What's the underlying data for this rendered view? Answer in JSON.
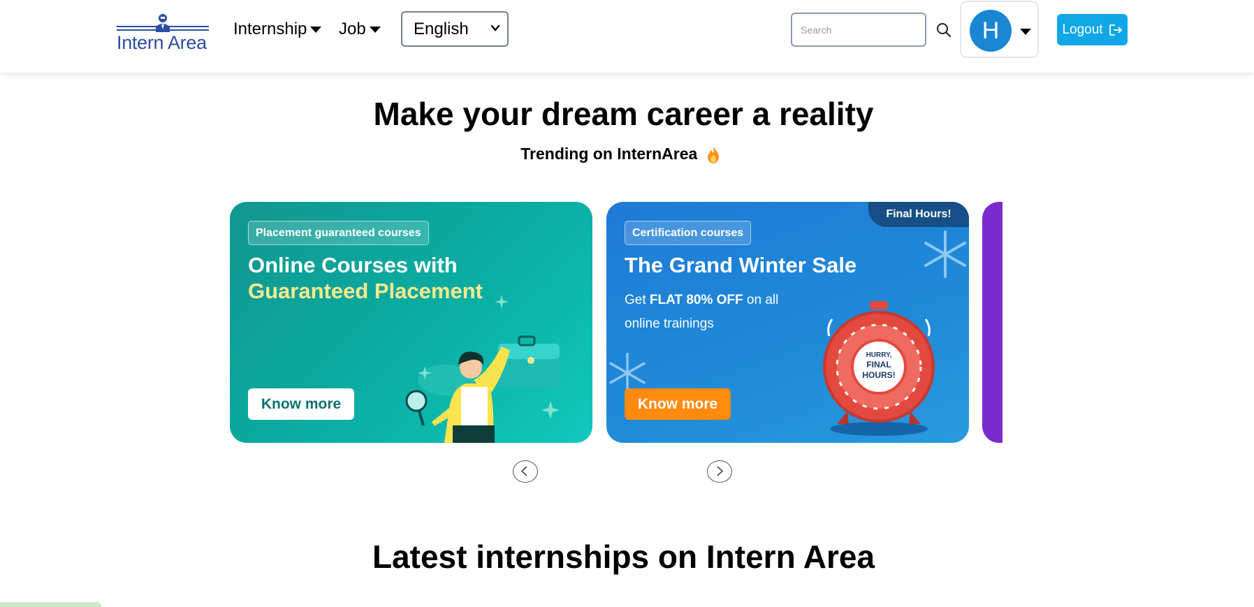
{
  "nav": {
    "logo_text": "Intern Area",
    "internship_label": "Internship",
    "job_label": "Job",
    "language_selected": "English",
    "search_placeholder": "Search",
    "avatar_initial": "H",
    "logout_label": "Logout"
  },
  "hero": {
    "title": "Make your dream career a reality",
    "trending": "Trending on InternArea"
  },
  "cards": [
    {
      "tag": "Placement guaranteed courses",
      "title_line1": "Online Courses with",
      "title_line2": "Guaranteed Placement",
      "button": "Know more"
    },
    {
      "tag": "Certification courses",
      "badge": "Final Hours!",
      "title": "The Grand Winter Sale",
      "promo_pre": "Get ",
      "promo_bold": "FLAT 80% OFF",
      "promo_post": " on all online trainings",
      "clock_text_1": "HURRY,",
      "clock_text_2": "FINAL",
      "clock_text_3": "HOURS!",
      "button": "Know more"
    }
  ],
  "latest": {
    "title": "Latest internships on Intern Area"
  },
  "colors": {
    "brand": "#2b4ea0",
    "logout_bg": "#10a7e7",
    "avatar_bg": "#1b86d4",
    "card1_bg": "#0aaea3",
    "card2_bg": "#1f8ad8",
    "card3_bg": "#7b2ad0",
    "orange_button": "#ff8a0d"
  }
}
